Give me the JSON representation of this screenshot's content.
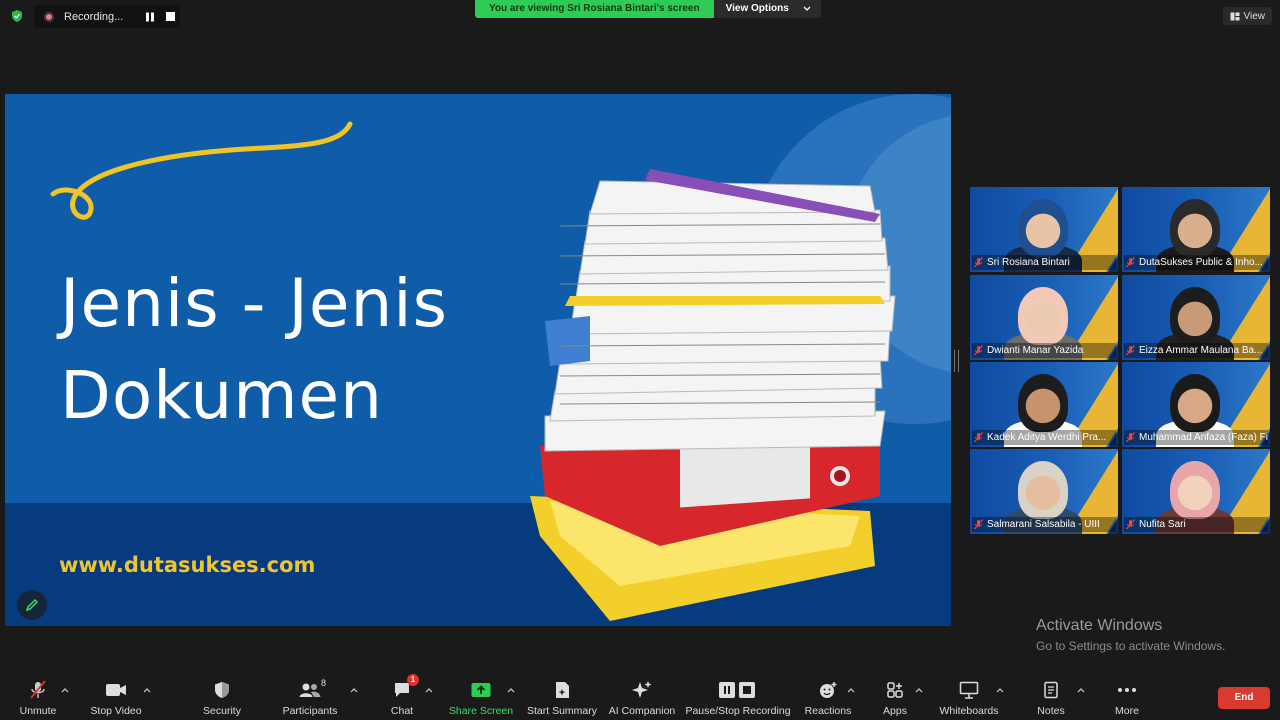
{
  "top": {
    "recording_label": "Recording...",
    "viewing_banner": "You are viewing Sri Rosiana Bintari's screen",
    "view_options": "View Options",
    "view_button": "View"
  },
  "slide": {
    "title_line1": "Jenis - Jenis",
    "title_line2": "Dokumen",
    "url": "www.dutasukses.com"
  },
  "participants": [
    {
      "name": "Sri Rosiana Bintari",
      "active": true
    },
    {
      "name": "DutaSukses Public & Inho..."
    },
    {
      "name": "Dwianti Manar Yazida"
    },
    {
      "name": "Eizza Ammar Maulana Ba..."
    },
    {
      "name": "Kadek Aditya Werdhi Pra..."
    },
    {
      "name": "Muhammad Anfaza (Faza) Fir..."
    },
    {
      "name": "Salmarani Salsabila - UIII"
    },
    {
      "name": "Nufita Sari"
    }
  ],
  "watermark": {
    "line1": "Activate Windows",
    "line2": "Go to Settings to activate Windows."
  },
  "toolbar": {
    "unmute": "Unmute",
    "stop_video": "Stop Video",
    "security": "Security",
    "participants": "Participants",
    "participants_count": "8",
    "chat": "Chat",
    "chat_badge": "1",
    "share_screen": "Share Screen",
    "start_summary": "Start Summary",
    "ai_companion": "AI Companion",
    "pause_stop": "Pause/Stop Recording",
    "reactions": "Reactions",
    "apps": "Apps",
    "whiteboards": "Whiteboards",
    "notes": "Notes",
    "more": "More",
    "end": "End"
  },
  "colors": {
    "slide_blue": "#0f5da8",
    "slide_accent_yellow": "#f0c531",
    "share_green": "#2ecc55",
    "end_red": "#d93a2f",
    "active_speaker": "#e7e45a"
  }
}
